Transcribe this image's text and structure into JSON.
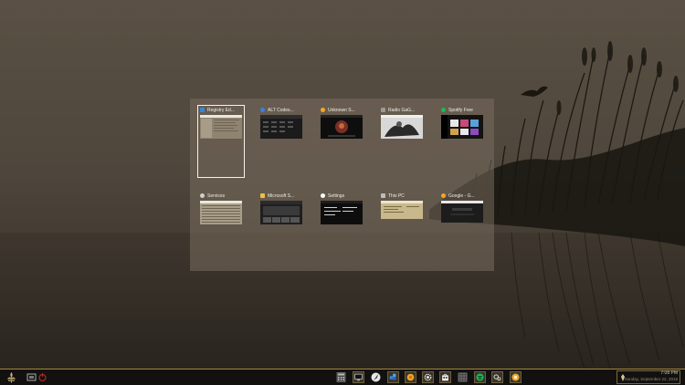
{
  "switcher": {
    "windows": [
      {
        "label": "Registry Ed...",
        "icon": "registry-icon",
        "icon_color": "#3a86d8",
        "selected": true
      },
      {
        "label": "ALT Codes...",
        "icon": "browser-icon",
        "icon_color": "#3c7fe0",
        "selected": false
      },
      {
        "label": "Unknown S...",
        "icon": "media-icon",
        "icon_color": "#f5a623",
        "selected": false
      },
      {
        "label": "Radio GaG...",
        "icon": "window-icon",
        "icon_color": "#9a9a9a",
        "selected": false
      },
      {
        "label": "Spotify Free",
        "icon": "spotify-icon",
        "icon_color": "#1db954",
        "selected": false
      },
      {
        "label": "Services",
        "icon": "services-icon",
        "icon_color": "#cfcfcf",
        "selected": false
      },
      {
        "label": "Microsoft S...",
        "icon": "store-icon",
        "icon_color": "#f0c040",
        "selected": false
      },
      {
        "label": "Settings",
        "icon": "gear-icon",
        "icon_color": "#ffffff",
        "selected": false
      },
      {
        "label": "This PC",
        "icon": "computer-icon",
        "icon_color": "#bdbdbd",
        "selected": false
      },
      {
        "label": "Google - G...",
        "icon": "google-icon",
        "icon_color": "#f5a623",
        "selected": false
      }
    ]
  },
  "taskbar": {
    "start_icon": "fleur-de-lis-icon",
    "pinned_apps": [
      "calculator-icon",
      "monitor-icon",
      "quill-icon",
      "registry-icon",
      "media-icon",
      "gear-icon",
      "store-icon",
      "spreadsheet-icon",
      "spotify-icon",
      "services-icon",
      "google-icon"
    ],
    "clock_time": "7:08 PM",
    "clock_date": "Sunday, September 22, 2019"
  },
  "colors": {
    "accent": "#a8883a",
    "switcher_bg": "#786c5c"
  }
}
